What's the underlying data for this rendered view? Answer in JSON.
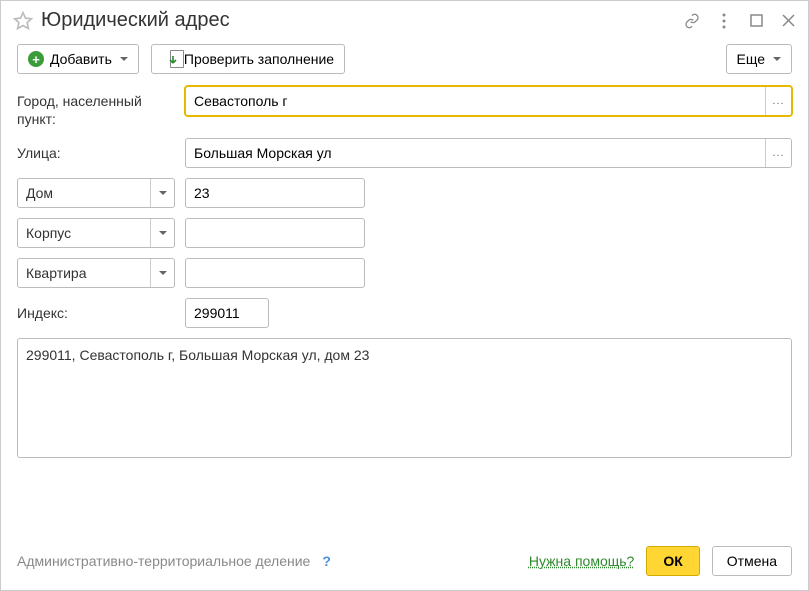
{
  "title": "Юридический адрес",
  "toolbar": {
    "add": "Добавить",
    "check": "Проверить заполнение",
    "more": "Еще"
  },
  "labels": {
    "city": "Город, населенный пункт:",
    "street": "Улица:",
    "house_type": "Дом",
    "building_type": "Корпус",
    "flat_type": "Квартира",
    "index": "Индекс:"
  },
  "values": {
    "city": "Севастополь г",
    "street": "Большая Морская ул",
    "house": "23",
    "building": "",
    "flat": "",
    "index": "299011",
    "full": "299011, Севастополь г, Большая Морская ул, дом 23"
  },
  "footer": {
    "admin": "Административно-территориальное деление",
    "help": "Нужна помощь?",
    "ok": "ОК",
    "cancel": "Отмена"
  }
}
